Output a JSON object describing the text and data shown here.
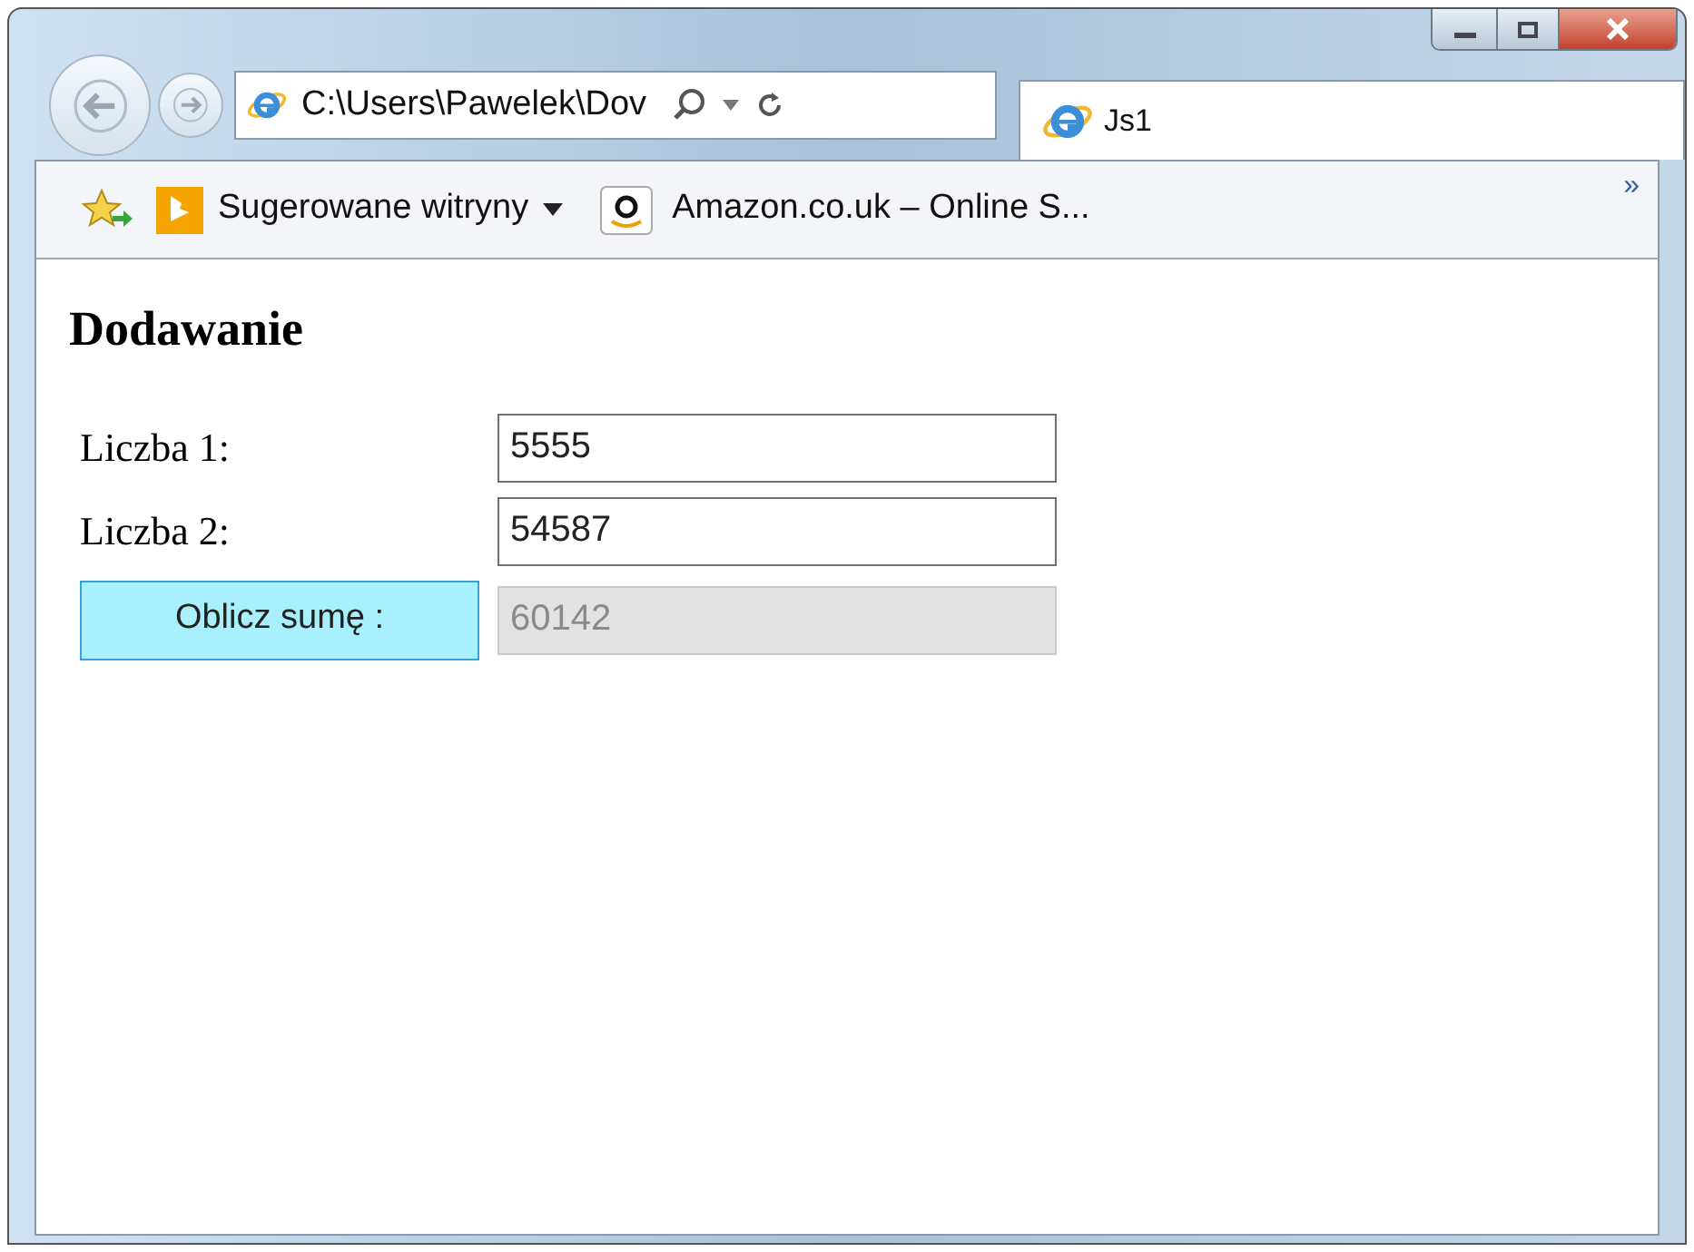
{
  "browser": {
    "address": "C:\\Users\\Pawelek\\Dov",
    "tab": {
      "title": "Js1",
      "selected": true
    },
    "favorites": [
      {
        "kind": "menu",
        "label": "Sugerowane witryny"
      },
      {
        "kind": "link",
        "label": "Amazon.co.uk – Online S..."
      }
    ],
    "overflow": "»"
  },
  "page": {
    "heading": "Dodawanie",
    "rows": [
      {
        "kind": "input",
        "label": "Liczba 1:",
        "value": "5555",
        "disabled": false
      },
      {
        "kind": "input",
        "label": "Liczba 2:",
        "value": "54587",
        "disabled": false
      },
      {
        "kind": "button",
        "label": "Oblicz sumę :",
        "value": "60142",
        "disabled": true
      }
    ]
  }
}
